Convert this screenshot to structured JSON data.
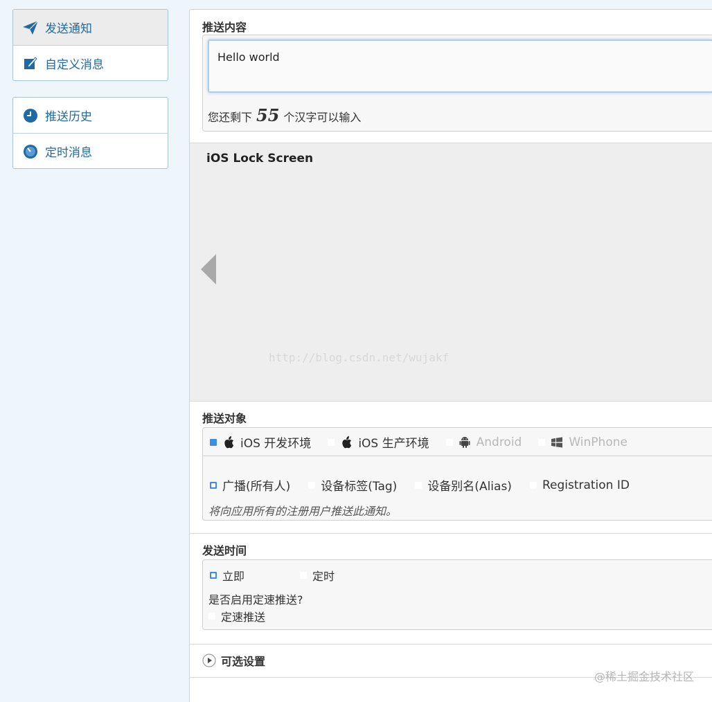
{
  "sidebar": {
    "group1": [
      {
        "label": "发送通知",
        "icon": "paper-plane-icon",
        "active": true
      },
      {
        "label": "自定义消息",
        "icon": "edit-icon",
        "active": false
      }
    ],
    "group2": [
      {
        "label": "推送历史",
        "icon": "clock-icon"
      },
      {
        "label": "定时消息",
        "icon": "timer-icon"
      }
    ]
  },
  "content": {
    "title": "推送内容",
    "message": "Hello world",
    "remain_prefix": "您还剩下",
    "remain_count": "55",
    "remain_suffix": "个汉字可以输入"
  },
  "preview": {
    "title": "iOS Lock Screen",
    "watermark": "http://blog.csdn.net/wujakf"
  },
  "target": {
    "title": "推送对象",
    "platforms": [
      {
        "label": "iOS 开发环境",
        "icon": "apple-icon",
        "checked": true,
        "disabled": false
      },
      {
        "label": "iOS 生产环境",
        "icon": "apple-icon",
        "checked": false,
        "disabled": false
      },
      {
        "label": "Android",
        "icon": "android-icon",
        "checked": false,
        "disabled": true
      },
      {
        "label": "WinPhone",
        "icon": "windows-icon",
        "checked": false,
        "disabled": true
      }
    ],
    "audience": [
      {
        "label": "广播(所有人)",
        "selected": true
      },
      {
        "label": "设备标签(Tag)",
        "selected": false
      },
      {
        "label": "设备别名(Alias)",
        "selected": false
      },
      {
        "label": "Registration ID",
        "selected": false
      }
    ],
    "hint": "将向应用所有的注册用户推送此通知。"
  },
  "send_time": {
    "title": "发送时间",
    "options": [
      {
        "label": "立即",
        "selected": true
      },
      {
        "label": "定时",
        "selected": false
      }
    ],
    "speed_question": "是否启用定速推送?",
    "speed_option": "定速推送"
  },
  "optional": {
    "title": "可选设置"
  },
  "footer": {
    "watermark": "@稀土掘金技术社区"
  },
  "colors": {
    "accent": "#1f6aa5",
    "radio_on": "#3a8ee6"
  }
}
